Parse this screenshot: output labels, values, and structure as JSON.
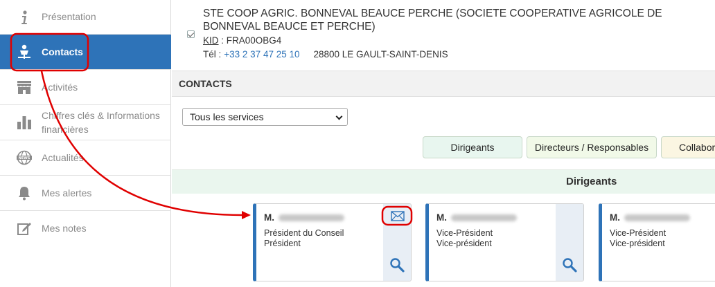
{
  "sidebar": {
    "items": [
      {
        "label": "Présentation",
        "icon": "info-icon"
      },
      {
        "label": "Contacts",
        "icon": "contact-person-icon",
        "active": true
      },
      {
        "label": "Activités",
        "icon": "storefront-icon"
      },
      {
        "label": "Chiffres clés & Informations financières",
        "icon": "bar-chart-icon"
      },
      {
        "label": "Actualités",
        "icon": "news-globe-icon"
      },
      {
        "label": "Mes alertes",
        "icon": "bell-icon"
      },
      {
        "label": "Mes notes",
        "icon": "edit-note-icon"
      }
    ]
  },
  "company": {
    "name": "STE COOP AGRIC. BONNEVAL BEAUCE PERCHE (SOCIETE COOPERATIVE AGRICOLE DE BONNEVAL BEAUCE ET PERCHE)",
    "kid_label": "KID",
    "kid_value": " : FRA00OBG4",
    "tel_label": "Tél :",
    "tel_value": "+33 2 37 47 25 10",
    "address": "28800 LE GAULT-SAINT-DENIS"
  },
  "contacts": {
    "section_title": "CONTACTS",
    "service_select": "Tous les services",
    "filters": [
      "Dirigeants",
      "Directeurs / Responsables",
      "Collabor"
    ],
    "group_title": "Dirigeants",
    "cards": [
      {
        "civility": "M.",
        "role1": "Président du Conseil",
        "role2": "Président",
        "has_mail": true
      },
      {
        "civility": "M.",
        "role1": "Vice-Président",
        "role2": "Vice-président",
        "has_mail": false
      },
      {
        "civility": "M.",
        "role1": "Vice-Président",
        "role2": "Vice-président",
        "has_mail": false
      }
    ]
  },
  "colors": {
    "accent": "#2e73b8",
    "annotation": "#e00000"
  }
}
